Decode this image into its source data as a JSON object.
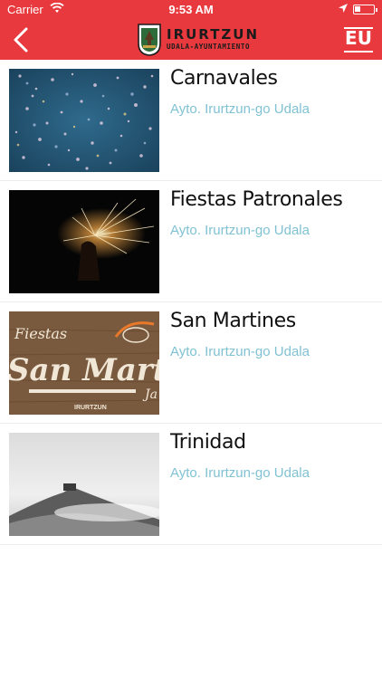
{
  "status": {
    "carrier": "Carrier",
    "time": "9:53 AM"
  },
  "header": {
    "logo_name": "IRURTZUN",
    "logo_sub": "UDALA-AYUNTAMIENTO",
    "lang_label": "EU",
    "accent_color": "#e83a3e"
  },
  "events": [
    {
      "title": "Carnavales",
      "subtitle": "Ayto. Irurtzun-go Udala"
    },
    {
      "title": "Fiestas Patronales",
      "subtitle": "Ayto. Irurtzun-go Udala"
    },
    {
      "title": "San Martines",
      "subtitle": "Ayto. Irurtzun-go Udala",
      "image_text_1": "Fiestas",
      "image_text_2": "San Martin",
      "image_text_3": "IRURTZUN",
      "image_text_4": "Ja"
    },
    {
      "title": "Trinidad",
      "subtitle": "Ayto. Irurtzun-go Udala"
    }
  ]
}
